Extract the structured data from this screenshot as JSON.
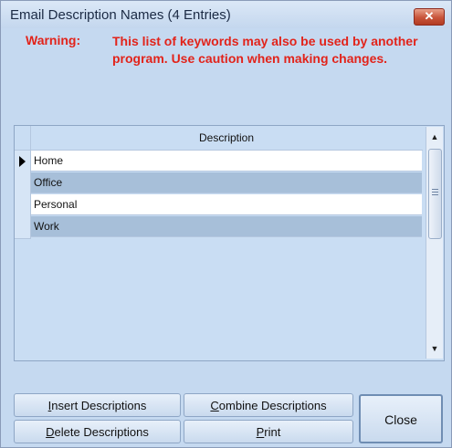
{
  "window": {
    "title": "Email Description Names (4 Entries)",
    "close_glyph": "✕"
  },
  "warning": {
    "label": "Warning:",
    "text": "This list of keywords may also be used by another program. Use caution when making changes."
  },
  "grid": {
    "column_header": "Description",
    "rows": [
      {
        "text": "Home",
        "current": true
      },
      {
        "text": "Office",
        "current": false
      },
      {
        "text": "Personal",
        "current": false
      },
      {
        "text": "Work",
        "current": false
      }
    ],
    "scroll_up_glyph": "▲",
    "scroll_down_glyph": "▼"
  },
  "buttons": {
    "insert": {
      "accel": "I",
      "rest": "nsert Descriptions"
    },
    "combine": {
      "accel": "C",
      "rest": "ombine Descriptions"
    },
    "delete": {
      "accel": "D",
      "rest": "elete Descriptions"
    },
    "print": {
      "accel": "P",
      "rest": "rint"
    },
    "close": "Close"
  },
  "colors": {
    "dialog_bg": "#c5d9f0",
    "warning_red": "#e2231a",
    "alt_row": "#a7bfd9"
  }
}
